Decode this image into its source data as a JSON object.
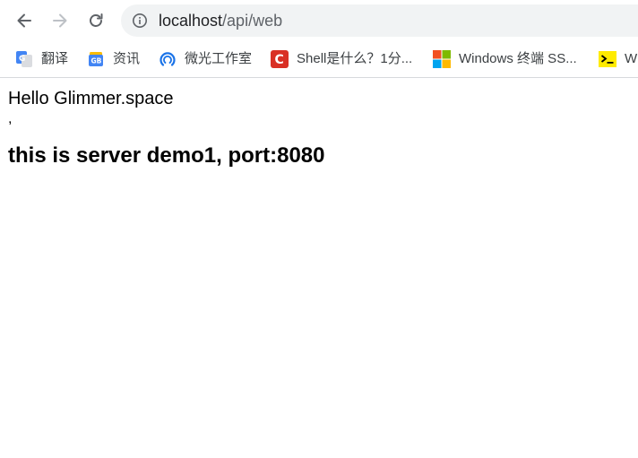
{
  "browser": {
    "url_host": "localhost",
    "url_path": "/api/web"
  },
  "bookmarks": [
    {
      "label": "翻译",
      "icon": "google-translate-icon"
    },
    {
      "label": "资讯",
      "icon": "google-news-icon"
    },
    {
      "label": "微光工作室",
      "icon": "microlight-studio-icon"
    },
    {
      "label": "Shell是什么？1分...",
      "icon": "c-logo-icon"
    },
    {
      "label": "Windows 终端 SS...",
      "icon": "windows-logo-icon"
    },
    {
      "label": "W",
      "icon": "terminal-icon"
    }
  ],
  "page": {
    "greeting": "Hello Glimmer.space",
    "comma": ",",
    "heading": "this is server demo1, port:8080"
  },
  "colors": {
    "omnibox_bg": "#f1f3f4",
    "c_logo": "#d93025",
    "terminal_bg": "#ffeb00"
  }
}
